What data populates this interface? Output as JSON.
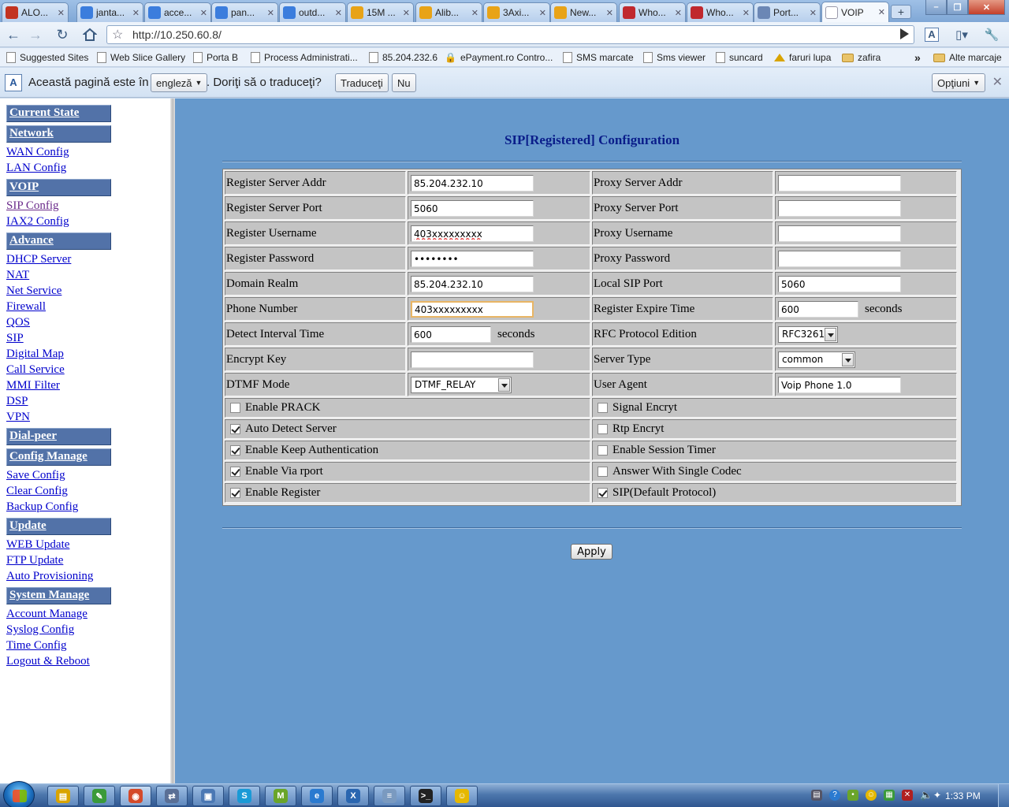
{
  "browser": {
    "tabs": [
      {
        "label": "ALO...",
        "icon": "gmail-icon",
        "color": "#c23321"
      },
      {
        "label": "janta...",
        "icon": "google-icon",
        "color": "#3b7ddd"
      },
      {
        "label": "acce...",
        "icon": "google-icon",
        "color": "#3b7ddd"
      },
      {
        "label": "pan...",
        "icon": "google-icon",
        "color": "#3b7ddd"
      },
      {
        "label": "outd...",
        "icon": "google-icon",
        "color": "#3b7ddd"
      },
      {
        "label": "15M ...",
        "icon": "alibaba-icon",
        "color": "#e8a317"
      },
      {
        "label": "Alib...",
        "icon": "alibaba-icon",
        "color": "#e8a317"
      },
      {
        "label": "3Axi...",
        "icon": "alibaba-icon",
        "color": "#e8a317"
      },
      {
        "label": "New...",
        "icon": "alibaba-icon",
        "color": "#e8a317"
      },
      {
        "label": "Who...",
        "icon": "cart-icon",
        "color": "#c0282e"
      },
      {
        "label": "Who...",
        "icon": "cart-icon",
        "color": "#c0282e"
      },
      {
        "label": "Port...",
        "icon": "page-icon",
        "color": "#6b87b5"
      },
      {
        "label": "VOIP",
        "icon": "page-icon",
        "color": "#ffffff"
      }
    ],
    "url": "http://10.250.60.8/",
    "bookmarks": [
      {
        "label": "Suggested Sites",
        "kind": "page"
      },
      {
        "label": "Web Slice Gallery",
        "kind": "page"
      },
      {
        "label": "Porta B",
        "kind": "page"
      },
      {
        "label": "Process Administrati...",
        "kind": "page"
      },
      {
        "label": "85.204.232.6",
        "kind": "page"
      },
      {
        "label": "ePayment.ro Contro...",
        "kind": "lock"
      },
      {
        "label": "SMS marcate",
        "kind": "page"
      },
      {
        "label": "Sms viewer",
        "kind": "page"
      },
      {
        "label": "suncard",
        "kind": "page"
      },
      {
        "label": "faruri lupa",
        "kind": "diamond"
      },
      {
        "label": "zafira",
        "kind": "folder"
      }
    ],
    "bookmarks_more": "»",
    "other_bookmarks": "Alte marcaje",
    "translate": {
      "prefix": "Această pagină este în",
      "language": "engleză",
      "question": ". Doriţi să o traduceţi?",
      "translate_btn": "Traduceţi",
      "no_btn": "Nu",
      "options_btn": "Opţiuni"
    }
  },
  "sidebar": {
    "sections": [
      {
        "title": "Current State",
        "items": []
      },
      {
        "title": "Network",
        "items": [
          "WAN Config",
          "LAN Config"
        ]
      },
      {
        "title": "VOIP",
        "items": [
          "SIP Config",
          "IAX2 Config"
        ]
      },
      {
        "title": "Advance",
        "items": [
          "DHCP Server",
          "NAT",
          "Net Service",
          "Firewall",
          "QOS",
          "SIP",
          "Digital Map",
          "Call Service",
          "MMI Filter",
          "DSP",
          "VPN"
        ]
      },
      {
        "title": "Dial-peer",
        "items": []
      },
      {
        "title": "Config Manage",
        "items": [
          "Save Config",
          "Clear Config",
          "Backup Config"
        ]
      },
      {
        "title": "Update",
        "items": [
          "WEB Update",
          "FTP Update",
          "Auto Provisioning"
        ]
      },
      {
        "title": "System Manage",
        "items": [
          "Account Manage",
          "Syslog Config",
          "Time Config",
          "Logout & Reboot"
        ]
      }
    ]
  },
  "main": {
    "title": "SIP[Registered] Configuration",
    "rows": [
      {
        "left": {
          "label": "Register Server Addr",
          "type": "text",
          "value": "85.204.232.10"
        },
        "right": {
          "label": "Proxy Server Addr",
          "type": "text",
          "value": ""
        }
      },
      {
        "left": {
          "label": "Register Server Port",
          "type": "text",
          "value": "5060"
        },
        "right": {
          "label": "Proxy Server Port",
          "type": "text",
          "value": ""
        }
      },
      {
        "left": {
          "label": "Register Username",
          "type": "text",
          "value": "403xxxxxxxxx"
        },
        "right": {
          "label": "Proxy Username",
          "type": "text",
          "value": ""
        }
      },
      {
        "left": {
          "label": "Register Password",
          "type": "password",
          "value": "••••••••"
        },
        "right": {
          "label": "Proxy Password",
          "type": "password",
          "value": ""
        }
      },
      {
        "left": {
          "label": "Domain Realm",
          "type": "text",
          "value": "85.204.232.10"
        },
        "right": {
          "label": "Local SIP Port",
          "type": "text",
          "value": "5060"
        }
      },
      {
        "left": {
          "label": "Phone Number",
          "type": "text",
          "value": "403xxxxxxxxx"
        },
        "right": {
          "label": "Register Expire Time",
          "type": "text",
          "value": "600",
          "unit": "seconds"
        }
      },
      {
        "left": {
          "label": "Detect Interval Time",
          "type": "text",
          "value": "600",
          "unit": "seconds"
        },
        "right": {
          "label": "RFC Protocol Edition",
          "type": "select",
          "value": "RFC3261"
        }
      },
      {
        "left": {
          "label": "Encrypt Key",
          "type": "text",
          "value": ""
        },
        "right": {
          "label": "Server Type",
          "type": "select",
          "value": "common"
        }
      },
      {
        "left": {
          "label": "DTMF Mode",
          "type": "select",
          "value": "DTMF_RELAY"
        },
        "right": {
          "label": "User Agent",
          "type": "text",
          "value": "Voip Phone 1.0"
        }
      }
    ],
    "checkboxes": [
      {
        "left": {
          "label": "Enable PRACK",
          "checked": false
        },
        "right": {
          "label": "Signal Encryt",
          "checked": false
        }
      },
      {
        "left": {
          "label": "Auto Detect Server",
          "checked": true
        },
        "right": {
          "label": "Rtp Encryt",
          "checked": false
        }
      },
      {
        "left": {
          "label": "Enable Keep Authentication",
          "checked": true
        },
        "right": {
          "label": "Enable Session Timer",
          "checked": false
        }
      },
      {
        "left": {
          "label": "Enable Via rport",
          "checked": true
        },
        "right": {
          "label": "Answer With Single Codec",
          "checked": false
        }
      },
      {
        "left": {
          "label": "Enable Register",
          "checked": true
        },
        "right": {
          "label": "SIP(Default Protocol)",
          "checked": true
        }
      }
    ],
    "apply_label": "Apply"
  },
  "taskbar": {
    "apps": [
      {
        "icon": "explorer-icon",
        "color": "#d9a400"
      },
      {
        "icon": "paint-icon",
        "color": "#3a9a3a"
      },
      {
        "icon": "chrome-icon",
        "color": "#d44a2a"
      },
      {
        "icon": "network-icon",
        "color": "#5a6f95"
      },
      {
        "icon": "remote-desktop-icon",
        "color": "#4b78b4"
      },
      {
        "icon": "skype-icon",
        "color": "#1a9ad6"
      },
      {
        "icon": "messenger-icon",
        "color": "#6aa52a"
      },
      {
        "icon": "ie-icon",
        "color": "#2a7ad0"
      },
      {
        "icon": "x-app-icon",
        "color": "#2a66b0"
      },
      {
        "icon": "notepad-icon",
        "color": "#7a9ac0"
      },
      {
        "icon": "cmd-icon",
        "color": "#222222"
      },
      {
        "icon": "yahoo-messenger-icon",
        "color": "#e6b800"
      }
    ],
    "clock": "1:33 PM"
  }
}
